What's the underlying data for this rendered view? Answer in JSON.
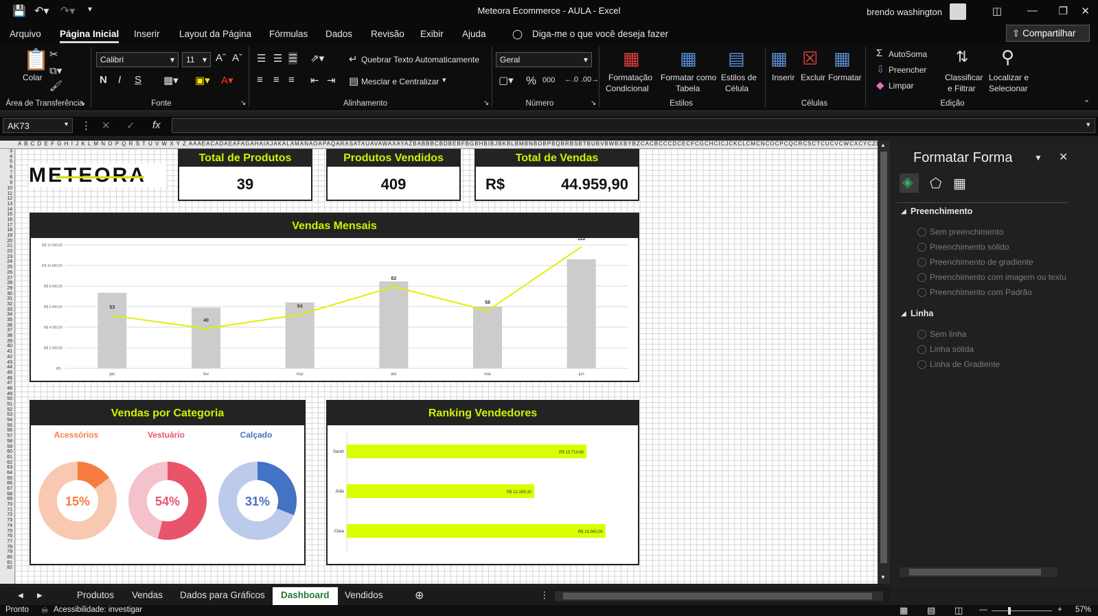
{
  "window": {
    "title": "Meteora Ecommerce - AULA  -  Excel",
    "user": "brendo washington"
  },
  "menu": [
    "Arquivo",
    "Página Inicial",
    "Inserir",
    "Layout da Página",
    "Fórmulas",
    "Dados",
    "Revisão",
    "Exibir",
    "Ajuda"
  ],
  "menu_active": "Página Inicial",
  "tellme": "Diga-me o que você deseja fazer",
  "share": "Compartilhar",
  "ribbon": {
    "clipboard": {
      "paste": "Colar",
      "label": "Área de Transferência"
    },
    "font": {
      "name": "Calibri",
      "size": "11",
      "bold": "N",
      "italic": "I",
      "underline": "S",
      "label": "Fonte"
    },
    "alignment": {
      "wrap": "Quebrar Texto Automaticamente",
      "merge": "Mesclar e Centralizar",
      "label": "Alinhamento"
    },
    "number": {
      "format": "Geral",
      "label": "Número"
    },
    "styles": {
      "cond1": "Formatação",
      "cond2": "Condicional",
      "table1": "Formatar como",
      "table2": "Tabela",
      "cell1": "Estilos de",
      "cell2": "Célula",
      "label": "Estilos"
    },
    "cells": {
      "insert": "Inserir",
      "delete": "Excluir",
      "format": "Formatar",
      "label": "Células"
    },
    "editing": {
      "autosum": "AutoSoma",
      "fill": "Preencher",
      "clear": "Limpar",
      "sort1": "Classificar",
      "sort2": "e Filtrar",
      "find1": "Localizar e",
      "find2": "Selecionar",
      "label": "Edição"
    }
  },
  "namebox": "AK73",
  "colheaders": "A B C D E F G H I J K L M N O P Q R S T U V W X Y Z AAAEACADAEAFAGAHAIAJAKALAMANAOAPAQARASATAUAVAWAXAYAZBABBBCBDBEBFBGBHBIBJBKBLBMBNBOBPBQBRBSBTBUBVBWBXBYBZCACBCCCDCECFCGCHCICJCKCLCMCNCOCPCQCRCSCTCUCVCWCXCYCZDADBDCDDDEDFDGDHDIDJDK",
  "rows": [
    "3",
    "4",
    "5",
    "6",
    "7",
    "8",
    "9",
    "10",
    "11",
    "12",
    "13",
    "14",
    "15",
    "16",
    "17",
    "18",
    "19",
    "20",
    "21",
    "22",
    "23",
    "24",
    "25",
    "26",
    "27",
    "28",
    "29",
    "30",
    "31",
    "32",
    "33",
    "34",
    "35",
    "36",
    "37",
    "38",
    "39",
    "40",
    "41",
    "42",
    "43",
    "44",
    "45",
    "46",
    "47",
    "48",
    "49",
    "50",
    "51",
    "52",
    "53",
    "54",
    "55",
    "56",
    "57",
    "58",
    "59",
    "60",
    "61",
    "62",
    "63",
    "64",
    "65",
    "66",
    "67",
    "68",
    "69",
    "70",
    "71",
    "72",
    "73",
    "74",
    "75",
    "76",
    "77",
    "78",
    "79",
    "80",
    "81",
    "82"
  ],
  "logo": "METEORA",
  "kpis": [
    {
      "title": "Total de Produtos",
      "value": "39"
    },
    {
      "title": "Produtos  Vendidos",
      "value": "409"
    },
    {
      "title": "Total de Vendas",
      "currency": "R$",
      "value": "44.959,90"
    }
  ],
  "monthly": {
    "title": "Vendas Mensais",
    "chart_data": {
      "type": "bar",
      "categories": [
        "jan",
        "fev",
        "mar",
        "abr",
        "mai",
        "jun"
      ],
      "series": [
        {
          "values": [
            7350,
            5900,
            6400,
            8450,
            6000,
            10600
          ]
        },
        {
          "values": [
            53,
            40,
            54,
            82,
            58,
            122
          ]
        }
      ],
      "ytick_labels": [
        "R$ 12.000,00",
        "R$ 10.000,00",
        "R$ 8.000,00",
        "R$ 6.000,00",
        "R$ 4.000,00",
        "R$ 2.000,00",
        "R$ -"
      ],
      "ylim": [
        0,
        12000
      ],
      "grid": true
    }
  },
  "category": {
    "title": "Vendas por Categoria",
    "chart_data": [
      {
        "type": "pie",
        "label": "Acessórios",
        "value": 15,
        "text": "15%",
        "color": "#F77C42",
        "track": "#F8C9B0"
      },
      {
        "type": "pie",
        "label": "Vestuário",
        "value": 54,
        "text": "54%",
        "color": "#E9546B",
        "track": "#F3C2CB"
      },
      {
        "type": "pie",
        "label": "Calçado",
        "value": 31,
        "text": "31%",
        "color": "#4472C4",
        "track": "#BCCBEB"
      }
    ]
  },
  "ranking": {
    "title": "Ranking Vendedores",
    "chart_data": {
      "type": "bar",
      "orientation": "horizontal",
      "categories": [
        "Sarah",
        "João",
        "Clara"
      ],
      "values": [
        15714.6,
        12285.3,
        16960.0
      ],
      "labels": [
        "R$ 15.714,60",
        "R$ 12.285,30",
        "R$ 16.960,00"
      ],
      "color": "#D9FF00"
    }
  },
  "pane": {
    "title": "Formatar Forma",
    "fill": {
      "heading": "Preenchimento",
      "options": [
        "Sem preenchimento",
        "Preenchimento sólido",
        "Preenchimento de gradiente",
        "Preenchimento com imagem ou textu",
        "Preenchimento com Padrão"
      ]
    },
    "line": {
      "heading": "Linha",
      "options": [
        "Sem linha",
        "Linha sólida",
        "Linha de Gradiente"
      ]
    }
  },
  "tabs": [
    "Produtos",
    "Vendas",
    "Dados para Gráficos",
    "Dashboard",
    "Vendidos"
  ],
  "active_tab": "Dashboard",
  "status": {
    "ready": "Pronto",
    "accessibility": "Acessibilidade: investigar",
    "zoom": "57%"
  }
}
